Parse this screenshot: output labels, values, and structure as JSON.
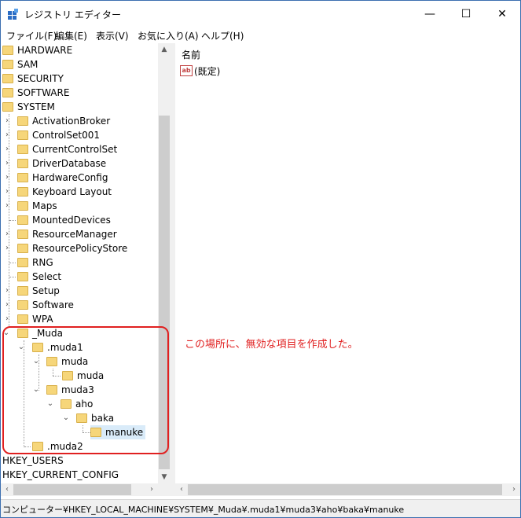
{
  "window": {
    "title": "レジストリ エディター",
    "controls": {
      "minimize": "—",
      "maximize": "☐",
      "close": "✕"
    }
  },
  "menu": [
    "ファイル(F)",
    "編集(E)",
    "表示(V)",
    "お気に入り(A)",
    "ヘルプ(H)"
  ],
  "tree": {
    "root_keys_top": [
      "HARDWARE",
      "SAM",
      "SECURITY",
      "SOFTWARE",
      "SYSTEM"
    ],
    "system_children": [
      "ActivationBroker",
      "ControlSet001",
      "CurrentControlSet",
      "DriverDatabase",
      "HardwareConfig",
      "Keyboard Layout",
      "Maps",
      "MountedDevices",
      "ResourceManager",
      "ResourcePolicyStore",
      "RNG",
      "Select",
      "Setup",
      "Software",
      "WPA"
    ],
    "muda": "_Muda",
    "muda1": ".muda1",
    "muda_a": "muda",
    "muda_b": "muda",
    "muda3": "muda3",
    "aho": "aho",
    "baka": "baka",
    "manuke": "manuke",
    "muda2": ".muda2",
    "hkey_users": "HKEY_USERS",
    "hkey_current_config": "HKEY_CURRENT_CONFIG"
  },
  "list": {
    "column_name": "名前",
    "rows": [
      {
        "name": "(既定)",
        "icon": "ab-icon"
      }
    ]
  },
  "annotation": "この場所に、無効な項目を作成した。",
  "status": "コンピューター¥HKEY_LOCAL_MACHINE¥SYSTEM¥_Muda¥.muda1¥muda3¥aho¥baka¥manuke",
  "colors": {
    "highlight": "#e02020",
    "folder": "#f6d67a",
    "selection": "#d9ebf9"
  }
}
